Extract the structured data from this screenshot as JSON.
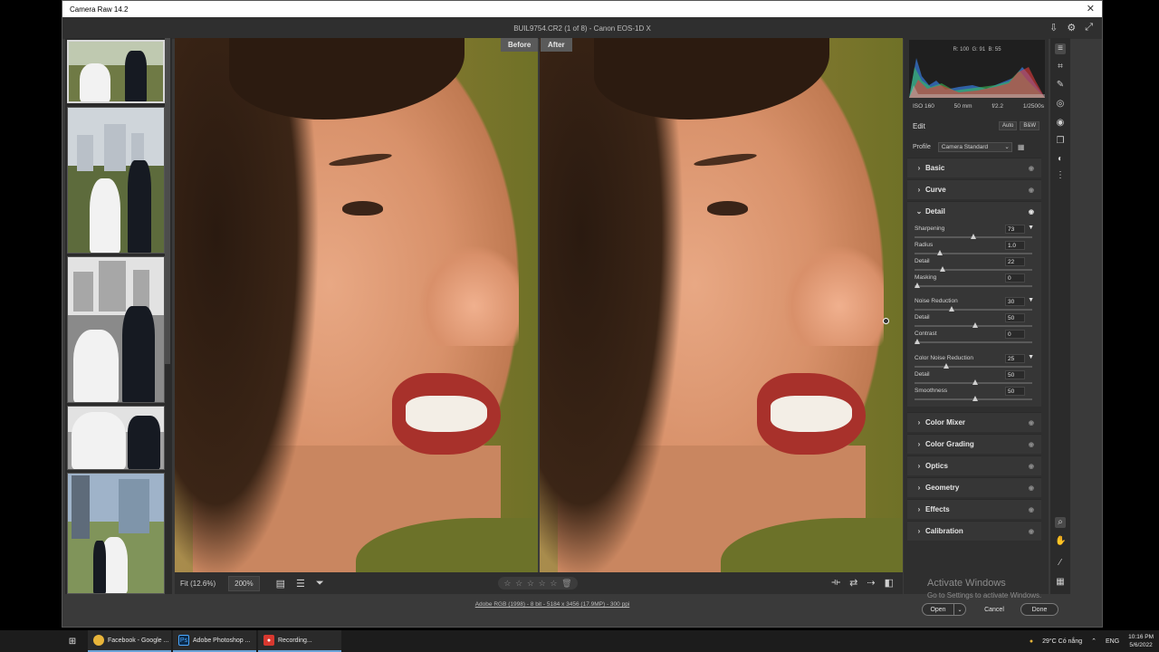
{
  "window": {
    "title": "Camera Raw 14.2",
    "file_info": "BUIL9754.CR2 (1 of 8)  -  Canon EOS-1D X"
  },
  "compare": {
    "before": "Before",
    "after": "After"
  },
  "histogram": {
    "r": "R: 100",
    "g": "G: 91",
    "b": "B: 55"
  },
  "exif": {
    "iso": "ISO 160",
    "focal": "50 mm",
    "aperture": "f/2.2",
    "shutter": "1/2500s"
  },
  "edit": {
    "label": "Edit",
    "auto": "Auto",
    "bw": "B&W",
    "profile_label": "Profile",
    "profile_value": "Camera Standard"
  },
  "sections": [
    {
      "label": "Basic",
      "open": false
    },
    {
      "label": "Curve",
      "open": false
    },
    {
      "label": "Detail",
      "open": true
    },
    {
      "label": "Color Mixer",
      "open": false
    },
    {
      "label": "Color Grading",
      "open": false
    },
    {
      "label": "Optics",
      "open": false
    },
    {
      "label": "Geometry",
      "open": false
    },
    {
      "label": "Effects",
      "open": false
    },
    {
      "label": "Calibration",
      "open": false
    }
  ],
  "detail": {
    "sharpening": {
      "label": "Sharpening",
      "value": "73",
      "fraction": 0.49
    },
    "radius": {
      "label": "Radius",
      "value": "1.0",
      "fraction": 0.2
    },
    "detail": {
      "label": "Detail",
      "value": "22",
      "fraction": 0.22
    },
    "masking": {
      "label": "Masking",
      "value": "0",
      "fraction": 0.0
    },
    "noise_reduction": {
      "label": "Noise Reduction",
      "value": "30",
      "fraction": 0.3
    },
    "nr_detail": {
      "label": "Detail",
      "value": "50",
      "fraction": 0.5
    },
    "nr_contrast": {
      "label": "Contrast",
      "value": "0",
      "fraction": 0.0
    },
    "color_nr": {
      "label": "Color Noise Reduction",
      "value": "25",
      "fraction": 0.25
    },
    "cnr_detail": {
      "label": "Detail",
      "value": "50",
      "fraction": 0.5
    },
    "cnr_smoothness": {
      "label": "Smoothness",
      "value": "50",
      "fraction": 0.5
    }
  },
  "bottom": {
    "fit": "Fit (12.6%)",
    "zoom": "200%"
  },
  "status": "Adobe RGB (1998) - 8 bit - 5184 x 3456 (17.9MP) - 300 ppi",
  "buttons": {
    "open": "Open",
    "cancel": "Cancel",
    "done": "Done"
  },
  "activation": {
    "line1": "Activate Windows",
    "line2": "Go to Settings to activate Windows."
  },
  "taskbar": {
    "tasks": [
      {
        "label": "Facebook - Google ...",
        "icon": "chrome-icon",
        "color": "#e9b53a"
      },
      {
        "label": "Adobe Photoshop ...",
        "icon": "photoshop-icon",
        "color": "#0b2a4a"
      },
      {
        "label": "Recording...",
        "icon": "recorder-icon",
        "color": "#d8382f"
      }
    ],
    "weather": "29°C  Có nắng",
    "lang": "ENG",
    "time": "10:16 PM",
    "date": "5/6/2022"
  }
}
